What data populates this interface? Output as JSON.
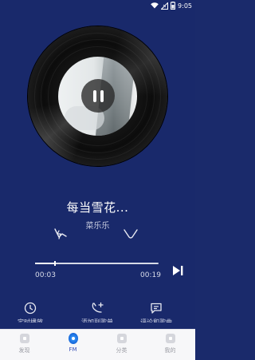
{
  "status_bar": {
    "time": "9:05",
    "icons": [
      "wifi-icon",
      "no-signal-icon",
      "battery-icon"
    ]
  },
  "player": {
    "song_title": "每当雪花...",
    "artist": "菜乐乐",
    "current_time": "00:03",
    "total_time": "00:19",
    "progress_fraction": 0.16,
    "state": "playing",
    "controls": [
      "pause-icon",
      "dislike-icon",
      "like-icon",
      "next-track-icon"
    ]
  },
  "actions": [
    {
      "name": "timer",
      "icon": "clock-icon",
      "label": "定时播放"
    },
    {
      "name": "add-to-playlist",
      "icon": "add-music-icon",
      "label": "添加到歌单"
    },
    {
      "name": "comments",
      "icon": "comment-icon",
      "label": "评论和歌曲"
    }
  ],
  "tabs": [
    {
      "name": "discover",
      "label": "发现",
      "active": false
    },
    {
      "name": "fm",
      "label": "FM",
      "active": true
    },
    {
      "name": "category",
      "label": "分类",
      "active": false
    },
    {
      "name": "mine",
      "label": "我的",
      "active": false
    }
  ],
  "colors": {
    "background": "#19296b",
    "tab_active": "#3b52b8",
    "fm_icon": "#1b6fe0"
  }
}
